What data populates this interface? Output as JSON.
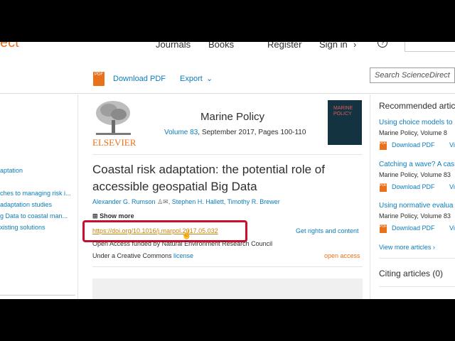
{
  "header": {
    "logo_partial": "ect",
    "nav": [
      "Journals",
      "Books",
      "Register",
      "Sign in"
    ],
    "help_icon": "question-circle-icon"
  },
  "toolbar": {
    "download_pdf": "Download PDF",
    "export": "Export",
    "search_placeholder": "Search ScienceDirect"
  },
  "outline": [
    "aptation",
    "ches to managing risk i...",
    "adaptation studies",
    "g Data to coastal man...",
    "xisting solutions"
  ],
  "journal": {
    "publisher": "ELSEVIER",
    "name": "Marine Policy",
    "volume_link": "Volume 83",
    "volume_rest": ", September 2017, Pages 100-110",
    "cover_title": "MARINE POLICY"
  },
  "article": {
    "title_line1": "Coastal risk adaptation: the potential role of",
    "title_line2": "accessible geospatial Big Data",
    "author1": "Alexander G. Rumson",
    "author2": "Stephen H. Hallett",
    "author3": "Timothy R. Brewer",
    "show_more": "Show more",
    "doi": "https://doi.org/10.1016/j.marpol.2017.05.032",
    "rights": "Get rights and content",
    "funding": "Open Access funded by Natural Environment Research Council",
    "license_prefix": "Under a Creative Commons ",
    "license_link": "license",
    "open_access": "open access"
  },
  "sidebar": {
    "recommended_title": "Recommended artic",
    "items": [
      {
        "title": "Using choice models to",
        "meta": "Marine Policy, Volume 8",
        "pdf": "Download PDF",
        "view": "Vi"
      },
      {
        "title": "Catching a wave? A cas",
        "meta": "Marine Policy, Volume 83",
        "pdf": "Download PDF",
        "view": "Vi"
      },
      {
        "title": "Using normative evalua",
        "meta": "Marine Policy, Volume 83",
        "pdf": "Download PDF",
        "view": "Vi"
      }
    ],
    "view_more": "View more articles",
    "citing": "Citing articles (0)"
  },
  "colors": {
    "link": "#0c7dbb",
    "orange": "#e9711c",
    "highlight": "#c8102e",
    "doi": "#c4820a"
  }
}
